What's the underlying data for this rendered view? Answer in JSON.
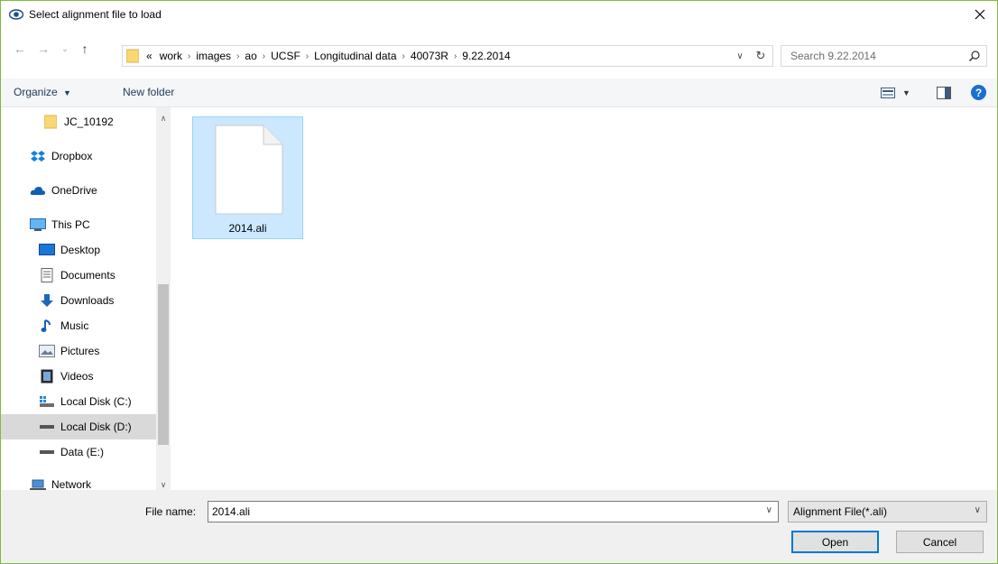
{
  "window": {
    "title": "Select alignment file to load"
  },
  "address": {
    "breadcrumb_prefix": "«",
    "crumbs": [
      "work",
      "images",
      "ao",
      "UCSF",
      "Longitudinal data",
      "40073R",
      "9.22.2014"
    ]
  },
  "search": {
    "placeholder": "Search 9.22.2014"
  },
  "toolbar": {
    "organize_label": "Organize",
    "new_folder_label": "New folder"
  },
  "nav": {
    "items": [
      {
        "label": "JC_10192",
        "icon": "folder-icon"
      },
      {
        "label": "Dropbox",
        "icon": "dropbox-icon"
      },
      {
        "label": "OneDrive",
        "icon": "onedrive-icon"
      },
      {
        "label": "This PC",
        "icon": "computer-icon"
      },
      {
        "label": "Desktop",
        "icon": "desktop-icon"
      },
      {
        "label": "Documents",
        "icon": "documents-icon"
      },
      {
        "label": "Downloads",
        "icon": "downloads-icon"
      },
      {
        "label": "Music",
        "icon": "music-icon"
      },
      {
        "label": "Pictures",
        "icon": "pictures-icon"
      },
      {
        "label": "Videos",
        "icon": "videos-icon"
      },
      {
        "label": "Local Disk (C:)",
        "icon": "system-drive-icon"
      },
      {
        "label": "Local Disk (D:)",
        "icon": "drive-icon"
      },
      {
        "label": "Data (E:)",
        "icon": "drive-icon"
      },
      {
        "label": "Network",
        "icon": "network-icon"
      }
    ],
    "selected": "Local Disk (D:)"
  },
  "files": [
    {
      "name": "2014.ali",
      "icon": "blank-file-icon",
      "selected": true
    }
  ],
  "bottom": {
    "filename_label": "File name:",
    "filename_value": "2014.ali",
    "filetype_value": "Alignment File(*.ali)",
    "open_label": "Open",
    "cancel_label": "Cancel"
  },
  "colors": {
    "accent": "#0078d7",
    "selection": "#cce8ff",
    "window_border": "#7fba3f",
    "help": "#1a6fd1"
  }
}
